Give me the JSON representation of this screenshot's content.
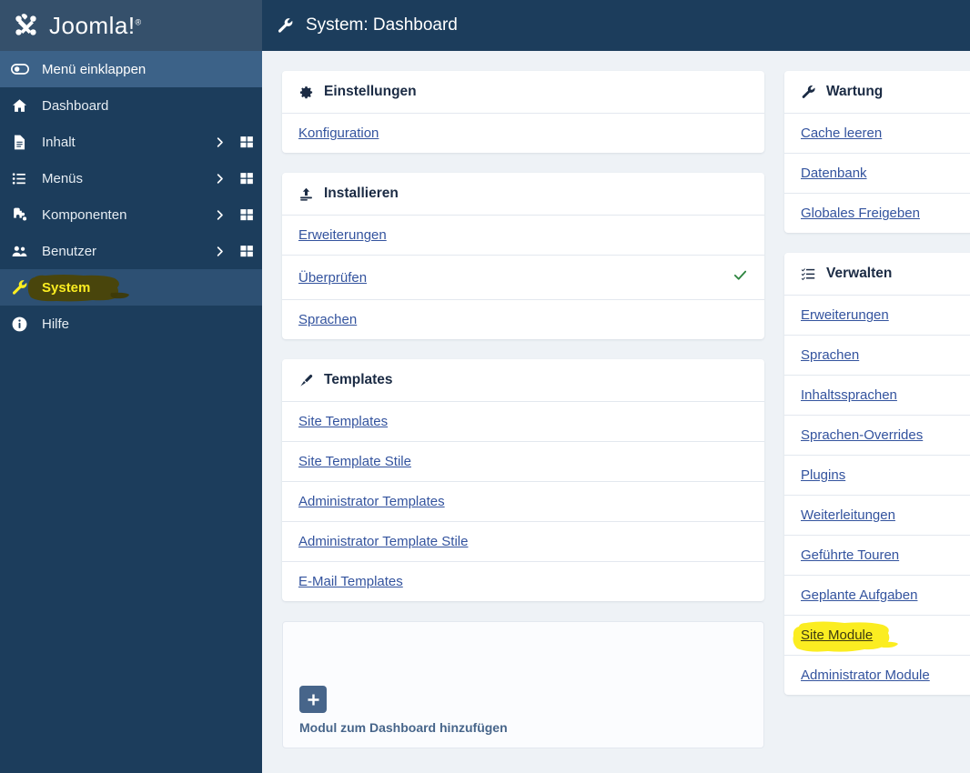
{
  "sidebar": {
    "brand": {
      "name": "Joomla!",
      "trademark": "®",
      "logo_icon": "joomla-logo-icon"
    },
    "collapse": {
      "label": "Menü einklappen",
      "icon": "toggle-collapse-icon"
    },
    "items": [
      {
        "label": "Dashboard",
        "icon": "home-icon",
        "has_chevron": false,
        "has_grid": false,
        "active": false,
        "highlighted": false
      },
      {
        "label": "Inhalt",
        "icon": "document-icon",
        "has_chevron": true,
        "has_grid": true,
        "active": false,
        "highlighted": false
      },
      {
        "label": "Menüs",
        "icon": "list-icon",
        "has_chevron": true,
        "has_grid": true,
        "active": false,
        "highlighted": false
      },
      {
        "label": "Komponenten",
        "icon": "puzzle-icon",
        "has_chevron": true,
        "has_grid": true,
        "active": false,
        "highlighted": false
      },
      {
        "label": "Benutzer",
        "icon": "users-icon",
        "has_chevron": true,
        "has_grid": true,
        "active": false,
        "highlighted": false
      },
      {
        "label": "System",
        "icon": "wrench-icon",
        "has_chevron": false,
        "has_grid": false,
        "active": true,
        "highlighted": true
      },
      {
        "label": "Hilfe",
        "icon": "info-icon",
        "has_chevron": false,
        "has_grid": false,
        "active": false,
        "highlighted": false
      }
    ]
  },
  "header": {
    "title": "System: Dashboard",
    "icon": "wrench-icon"
  },
  "panels": {
    "left": [
      {
        "title": "Einstellungen",
        "icon": "gear-icon",
        "rows": [
          {
            "label": "Konfiguration",
            "check": false,
            "highlighted": false
          }
        ]
      },
      {
        "title": "Installieren",
        "icon": "upload-icon",
        "rows": [
          {
            "label": "Erweiterungen",
            "check": false,
            "highlighted": false
          },
          {
            "label": "Überprüfen",
            "check": true,
            "highlighted": false
          },
          {
            "label": "Sprachen",
            "check": false,
            "highlighted": false
          }
        ]
      },
      {
        "title": "Templates",
        "icon": "paintbrush-icon",
        "rows": [
          {
            "label": "Site Templates",
            "check": false,
            "highlighted": false
          },
          {
            "label": "Site Template Stile",
            "check": false,
            "highlighted": false
          },
          {
            "label": "Administrator Templates",
            "check": false,
            "highlighted": false
          },
          {
            "label": "Administrator Template Stile",
            "check": false,
            "highlighted": false
          },
          {
            "label": "E-Mail Templates",
            "check": false,
            "highlighted": false
          }
        ]
      }
    ],
    "right": [
      {
        "title": "Wartung",
        "icon": "wrench-icon",
        "rows": [
          {
            "label": "Cache leeren",
            "check": false,
            "highlighted": false
          },
          {
            "label": "Datenbank",
            "check": false,
            "highlighted": false
          },
          {
            "label": "Globales Freigeben",
            "check": false,
            "highlighted": false
          }
        ]
      },
      {
        "title": "Verwalten",
        "icon": "list-check-icon",
        "rows": [
          {
            "label": "Erweiterungen",
            "check": false,
            "highlighted": false
          },
          {
            "label": "Sprachen",
            "check": false,
            "highlighted": false
          },
          {
            "label": "Inhaltssprachen",
            "check": false,
            "highlighted": false
          },
          {
            "label": "Sprachen-Overrides",
            "check": false,
            "highlighted": false
          },
          {
            "label": "Plugins",
            "check": false,
            "highlighted": false
          },
          {
            "label": "Weiterleitungen",
            "check": false,
            "highlighted": false
          },
          {
            "label": "Geführte Touren",
            "check": false,
            "highlighted": false
          },
          {
            "label": "Geplante Aufgaben",
            "check": false,
            "highlighted": false
          },
          {
            "label": "Site Module",
            "check": false,
            "highlighted": true
          },
          {
            "label": "Administrator Module",
            "check": false,
            "highlighted": false
          }
        ]
      }
    ]
  },
  "add_module": {
    "caption": "Modul zum Dashboard hinzufügen",
    "icon": "plus-icon"
  },
  "colors": {
    "sidebar_bg": "#1c3d5c",
    "sidebar_brand_bg": "#35506b",
    "sidebar_active": "#2d5073",
    "collapse_bg": "#3c6288",
    "topbar_bg": "#1c3d5c",
    "content_bg": "#eef2f6",
    "panel_bg": "#ffffff",
    "link": "#33539e",
    "check_green": "#2e8540",
    "highlighter_yellow": "#fbed21",
    "heading": "#1b2b44"
  }
}
